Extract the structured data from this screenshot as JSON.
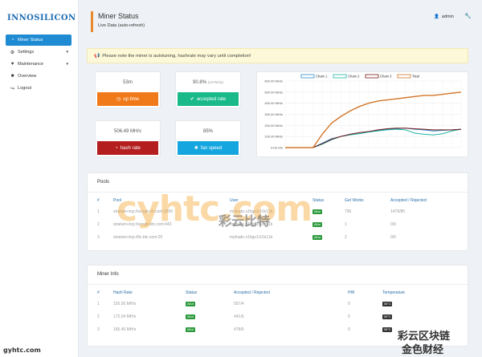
{
  "brand": {
    "logo": "INNOSILICON"
  },
  "sidebar": {
    "items": [
      {
        "label": "Miner Status",
        "icon": "dashboard-icon",
        "active": true,
        "chevron": false
      },
      {
        "label": "Settings",
        "icon": "gear-icon",
        "active": false,
        "chevron": true
      },
      {
        "label": "Maintenance",
        "icon": "heart-icon",
        "active": false,
        "chevron": true
      },
      {
        "label": "Overview",
        "icon": "book-icon",
        "active": false,
        "chevron": false
      },
      {
        "label": "Logout",
        "icon": "logout-icon",
        "active": false,
        "chevron": false
      }
    ]
  },
  "header": {
    "title": "Miner Status",
    "subtitle": "Live Data (auto-refresh)",
    "user": "admin"
  },
  "notice": {
    "text": "Please note the miner is autotuning, hashrate may vary until completion!"
  },
  "stats": {
    "uptime": {
      "value": "53m",
      "label": "up time",
      "color": "#f07a1a"
    },
    "accepted": {
      "value": "90.8%",
      "detail": "(1476/16)",
      "label": "accepted rate",
      "color": "#19b98a"
    },
    "hashrate": {
      "value": "506.49 MH/s",
      "label": "hash rate",
      "color": "#b41e1e"
    },
    "fan": {
      "value": "85%",
      "label": "fan speed",
      "color": "#15a6df"
    }
  },
  "chart_data": {
    "type": "line",
    "legend_position": "top-center",
    "y_ticks": [
      "600.00 MH/s",
      "500.00 MH/s",
      "400.00 MH/s",
      "300.00 MH/s",
      "200.00 MH/s",
      "100.00 MH/s",
      "0.00 H/s"
    ],
    "ylim": [
      0,
      600
    ],
    "x_count": 20,
    "series": [
      {
        "name": "Chain 1",
        "color": "#2a8cc8",
        "values": [
          0,
          0,
          0,
          0,
          40,
          80,
          100,
          120,
          135,
          145,
          155,
          165,
          170,
          175,
          165,
          160,
          150,
          155,
          160,
          165
        ]
      },
      {
        "name": "Chain 2",
        "color": "#1fb5a3",
        "values": [
          0,
          0,
          0,
          0,
          30,
          70,
          100,
          115,
          125,
          140,
          150,
          160,
          165,
          160,
          130,
          120,
          115,
          125,
          150,
          165
        ]
      },
      {
        "name": "Chain 3",
        "color": "#7a1a1a",
        "values": [
          0,
          0,
          0,
          0,
          35,
          75,
          100,
          120,
          135,
          145,
          160,
          170,
          175,
          175,
          170,
          165,
          160,
          160,
          160,
          165
        ]
      },
      {
        "name": "Total",
        "color": "#d2762a",
        "values": [
          0,
          0,
          0,
          0,
          120,
          220,
          280,
          330,
          370,
          400,
          420,
          430,
          440,
          450,
          460,
          470,
          470,
          480,
          490,
          500
        ]
      }
    ]
  },
  "pools": {
    "title": "Pools",
    "headers": [
      "#",
      "Pool",
      "User",
      "Status",
      "Get Works",
      "Accepted / Rejected"
    ],
    "rows": [
      {
        "n": "1",
        "pool": "stratum+tcp://scrypt.nh.com:3600",
        "user": "mytrade.s1hgs1r10x11b",
        "status": "Alive",
        "works": "796",
        "ar": "1476/80"
      },
      {
        "n": "2",
        "pool": "stratum+tcp://scrypt.btc.com:443",
        "user": "mytrade.s1hgs1r10x11b",
        "status": "Alive",
        "works": "1",
        "ar": "0/0"
      },
      {
        "n": "3",
        "pool": "stratum+tcp://ltc.btc.com:25",
        "user": "mytrade.s1hgs1r10x11b",
        "status": "Alive",
        "works": "2",
        "ar": "0/0"
      }
    ]
  },
  "minerinfo": {
    "title": "Miner Info",
    "headers": [
      "#",
      "Hash Rate",
      "Status",
      "Accepted / Rejected",
      "HW",
      "Temperature"
    ],
    "rows": [
      {
        "n": "1",
        "rate": "150.56 MH/s",
        "status": "Alive",
        "ar": "557/4",
        "hw": "0",
        "temp": "56°C"
      },
      {
        "n": "2",
        "rate": "172.54 MH/s",
        "status": "Alive",
        "ar": "441/6",
        "hw": "0",
        "temp": "56°C"
      },
      {
        "n": "3",
        "rate": "165.40 MH/s",
        "status": "Alive",
        "ar": "478/6",
        "hw": "0",
        "temp": "56°C"
      }
    ]
  },
  "watermarks": {
    "site": "gyhtc.com",
    "cn1": "彩云比特",
    "cn2": "彩云区块链",
    "cn3": "金色财经",
    "mid": "cyhtc.com"
  }
}
